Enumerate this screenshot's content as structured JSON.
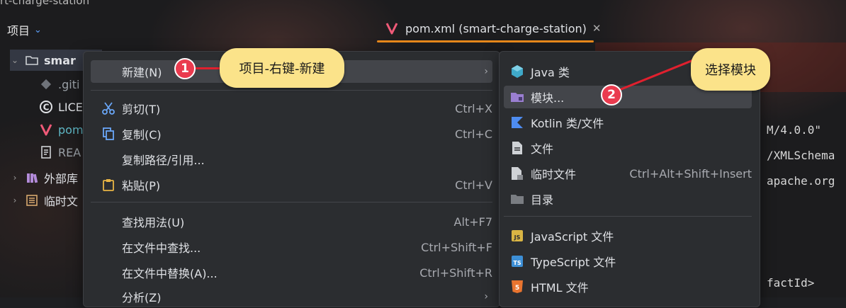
{
  "top_strip": "rt-charge-station",
  "project_panel": {
    "title": "项目"
  },
  "tree": [
    {
      "label": "smar",
      "icon": "folder-icon",
      "expanded": true
    },
    {
      "label": ".giti",
      "icon": "git-file-icon"
    },
    {
      "label": "LICE",
      "icon": "license-icon"
    },
    {
      "label": "pom",
      "icon": "maven-icon"
    },
    {
      "label": "REA",
      "icon": "readme-icon"
    },
    {
      "label": "外部库",
      "icon": "library-icon"
    },
    {
      "label": "临时文",
      "icon": "scratch-icon"
    }
  ],
  "editor_tab": {
    "label": "pom.xml (smart-charge-station)"
  },
  "code_lines": [
    "M/4.0.0\"",
    "/XMLSchema",
    "apache.org",
    "factId>"
  ],
  "context_menu": {
    "items": [
      {
        "label": "新建(N)",
        "shortcut": "",
        "icon": "",
        "submenu": true,
        "highlighted": true
      },
      {
        "label": "剪切(T)",
        "shortcut": "Ctrl+X",
        "icon": "scissors-icon"
      },
      {
        "label": "复制(C)",
        "shortcut": "Ctrl+C",
        "icon": "copy-icon"
      },
      {
        "label": "复制路径/引用...",
        "shortcut": "",
        "icon": ""
      },
      {
        "label": "粘贴(P)",
        "shortcut": "Ctrl+V",
        "icon": "paste-icon"
      },
      {
        "label": "查找用法(U)",
        "shortcut": "Alt+F7",
        "icon": ""
      },
      {
        "label": "在文件中查找...",
        "shortcut": "Ctrl+Shift+F",
        "icon": ""
      },
      {
        "label": "在文件中替换(A)...",
        "shortcut": "Ctrl+Shift+R",
        "icon": ""
      },
      {
        "label": "分析(Z)",
        "shortcut": "",
        "icon": "",
        "submenu": true
      }
    ]
  },
  "new_submenu": {
    "items": [
      {
        "label": "Java 类",
        "shortcut": "",
        "icon": "java-class-icon"
      },
      {
        "label": "模块...",
        "shortcut": "",
        "icon": "module-folder-icon",
        "highlighted": true
      },
      {
        "label": "Kotlin 类/文件",
        "shortcut": "",
        "icon": "kotlin-icon"
      },
      {
        "label": "文件",
        "shortcut": "",
        "icon": "file-icon"
      },
      {
        "label": "临时文件",
        "shortcut": "Ctrl+Alt+Shift+Insert",
        "icon": "scratch-file-icon"
      },
      {
        "label": "目录",
        "shortcut": "",
        "icon": "directory-icon"
      },
      {
        "label": "JavaScript 文件",
        "shortcut": "",
        "icon": "javascript-file-icon"
      },
      {
        "label": "TypeScript 文件",
        "shortcut": "",
        "icon": "typescript-file-icon"
      },
      {
        "label": "HTML 文件",
        "shortcut": "",
        "icon": "html-file-icon"
      }
    ]
  },
  "annotations": [
    {
      "badge": "1",
      "text": "项目-右键-新建"
    },
    {
      "badge": "2",
      "text": "选择模块"
    }
  ],
  "colors": {
    "accent_tab": "#e8891b",
    "callout": "#fbe38a",
    "badge": "#ea3b4f",
    "highlight": "#43454a"
  }
}
